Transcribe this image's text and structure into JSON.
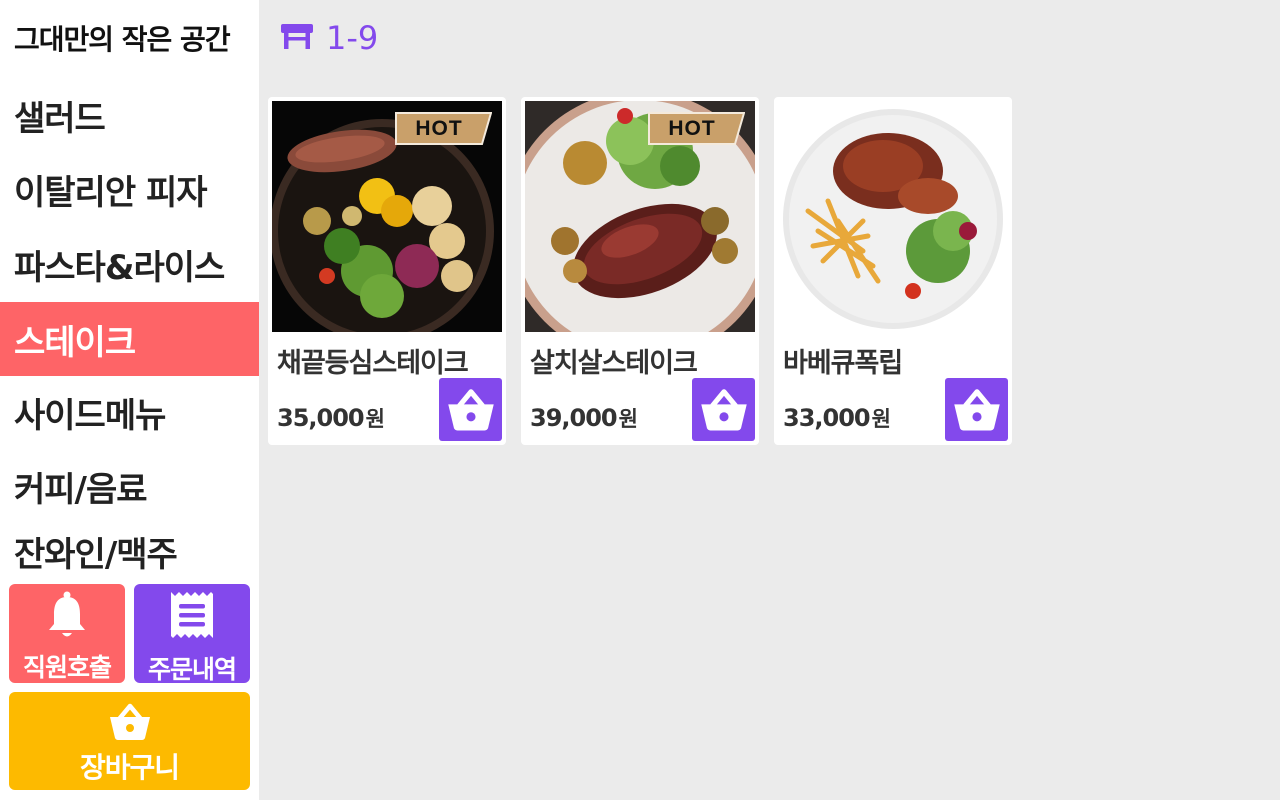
{
  "sidebar": {
    "brand": "그대만의 작은 공간",
    "categories": [
      {
        "label": "샐러드"
      },
      {
        "label": "이탈리안 피자"
      },
      {
        "label": "파스타&라이스"
      },
      {
        "label": "스테이크"
      },
      {
        "label": "사이드메뉴"
      },
      {
        "label": "커피/음료"
      },
      {
        "label": "잔와인/맥주"
      }
    ],
    "active_category": "스테이크",
    "staff_call_label": "직원호출",
    "order_history_label": "주문내역",
    "cart_label": "장바구니"
  },
  "header": {
    "table_icon": "table-icon",
    "table_number": "1-9"
  },
  "menu": {
    "items": [
      {
        "name": "채끝등심스테이크",
        "price": "35,000",
        "currency": "원",
        "badge": "HOT"
      },
      {
        "name": "살치살스테이크",
        "price": "39,000",
        "currency": "원",
        "badge": "HOT"
      },
      {
        "name": "바베큐폭립",
        "price": "33,000",
        "currency": "원",
        "badge": ""
      }
    ]
  },
  "colors": {
    "accent_purple": "#8349ec",
    "accent_red": "#fe6467",
    "cart_yellow": "#fdba00",
    "background": "#ebebeb"
  }
}
